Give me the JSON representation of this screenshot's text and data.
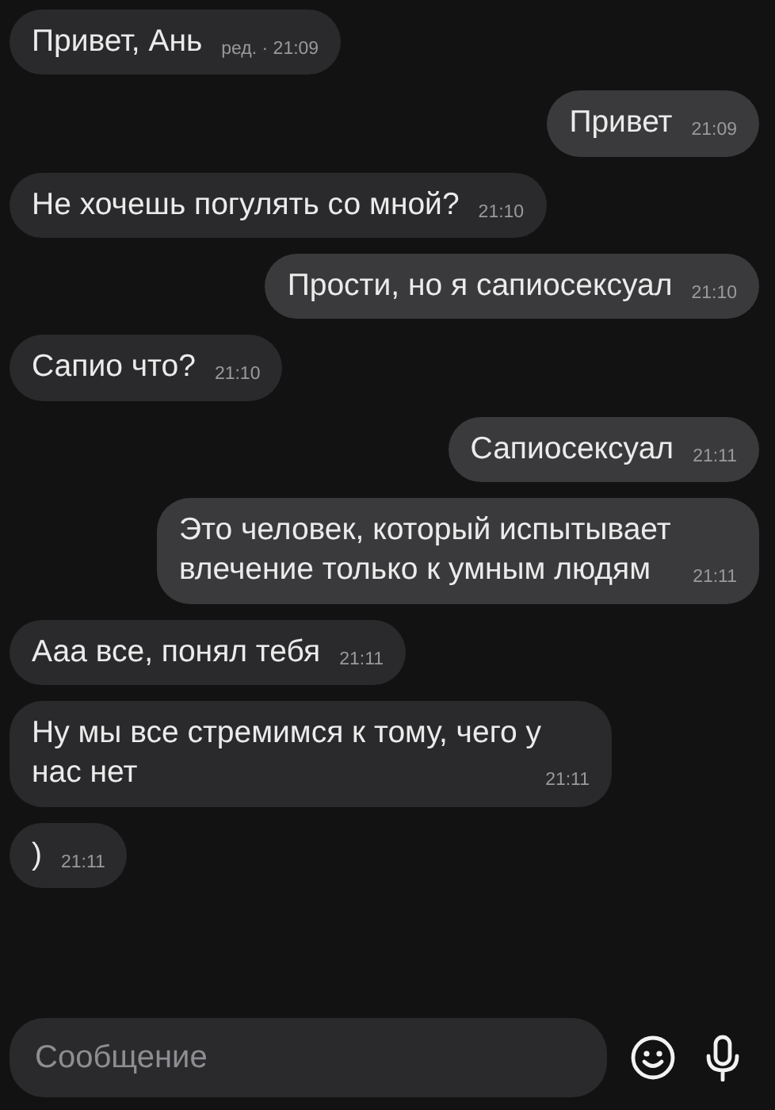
{
  "messages": [
    {
      "kind": "incoming",
      "text": "Привет, Ань",
      "time": "ред. · 21:09"
    },
    {
      "kind": "outgoing",
      "text": "Привет",
      "time": "21:09"
    },
    {
      "kind": "incoming",
      "text": "Не хочешь погулять со мной?",
      "time": "21:10"
    },
    {
      "kind": "outgoing",
      "text": "Прости, но я сапиосексуал",
      "time": "21:10"
    },
    {
      "kind": "incoming",
      "text": "Сапио что?",
      "time": "21:10"
    },
    {
      "kind": "outgoing",
      "text": "Сапиосексуал",
      "time": "21:11"
    },
    {
      "kind": "outgoing",
      "text": "Это человек, который испытывает влечение только к умным людям",
      "time": "21:11"
    },
    {
      "kind": "incoming",
      "text": "Ааа все, понял тебя",
      "time": "21:11"
    },
    {
      "kind": "incoming",
      "text": "Ну мы все стремимся к тому, чего у нас нет",
      "time": "21:11"
    },
    {
      "kind": "incoming",
      "text": ")",
      "time": "21:11"
    }
  ],
  "composer": {
    "placeholder": "Сообщение"
  }
}
